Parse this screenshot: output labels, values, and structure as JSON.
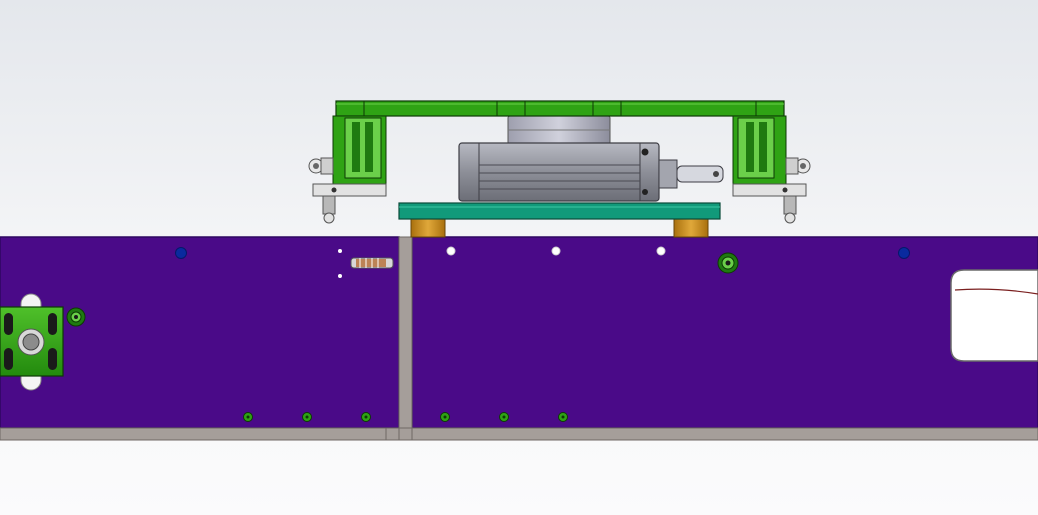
{
  "viewport": {
    "kind": "3D CAD model viewport",
    "background_top": "#e4e7ec",
    "background_bottom": "#fbfbfc"
  },
  "colors": {
    "frame_purple": "#4a0a88",
    "frame_edge": "#2e0660",
    "rail_gray": "#a59e9a",
    "bracket_green": "#2fa314",
    "bracket_light_green": "#6bd04a",
    "mounting_plate_teal": "#119a7a",
    "spacer_brass": "#c98e1c",
    "cylinder_gray": "#8d8f98",
    "hole_blue": "#0a2a9e",
    "window_white": "#ffffff"
  },
  "parts": [
    "purple-frame-panel-left",
    "purple-frame-panel-right",
    "bottom-rail",
    "vertical-post",
    "top-green-bridge-bracket",
    "left-gripper-bracket",
    "right-gripper-bracket",
    "teal-mounting-plate",
    "brass-spacer-left",
    "brass-spacer-right",
    "pneumatic-cylinder",
    "rotary-actuator-disc",
    "green-side-mount",
    "cutout-window"
  ]
}
